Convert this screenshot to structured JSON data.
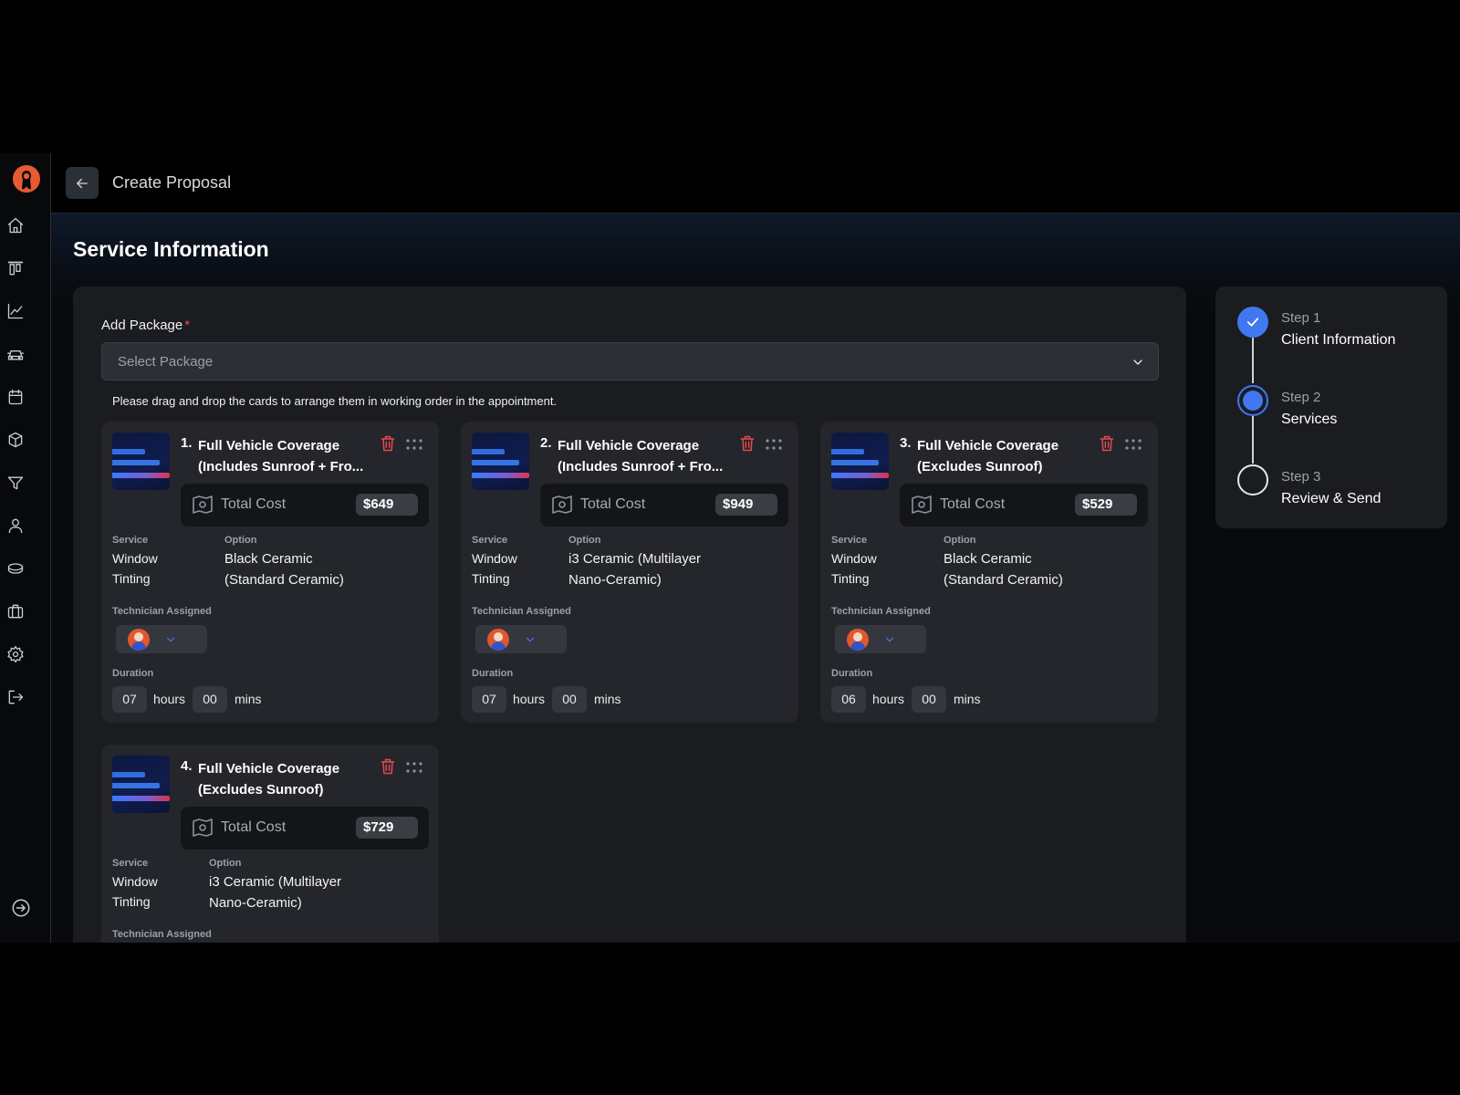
{
  "header": {
    "title": "Create Proposal"
  },
  "section": {
    "title": "Service Information"
  },
  "package": {
    "label": "Add Package",
    "required_mark": "*",
    "placeholder": "Select Package",
    "hint": "Please drag and drop the cards to arrange them in working order in the appointment."
  },
  "labels": {
    "total_cost": "Total Cost",
    "service": "Service",
    "option": "Option",
    "technician": "Technician Assigned",
    "duration": "Duration",
    "hours": "hours",
    "mins": "mins"
  },
  "cards": [
    {
      "num": "1.",
      "title_line1": "Full Vehicle Coverage",
      "title_line2": "(Includes Sunroof + Fro...",
      "cost": "$649",
      "service_line1": "Window",
      "service_line2": "Tinting",
      "option_line1": "Black Ceramic",
      "option_line2": "(Standard Ceramic)",
      "hours": "07",
      "mins": "00"
    },
    {
      "num": "2.",
      "title_line1": "Full Vehicle Coverage",
      "title_line2": "(Includes Sunroof + Fro...",
      "cost": "$949",
      "service_line1": "Window",
      "service_line2": "Tinting",
      "option_line1": "i3 Ceramic (Multilayer",
      "option_line2": "Nano-Ceramic)",
      "hours": "07",
      "mins": "00"
    },
    {
      "num": "3.",
      "title_line1": "Full Vehicle Coverage",
      "title_line2": "(Excludes Sunroof)",
      "cost": "$529",
      "service_line1": "Window",
      "service_line2": "Tinting",
      "option_line1": "Black Ceramic",
      "option_line2": "(Standard Ceramic)",
      "hours": "06",
      "mins": "00"
    },
    {
      "num": "4.",
      "title_line1": "Full Vehicle Coverage",
      "title_line2": "(Excludes Sunroof)",
      "cost": "$729",
      "service_line1": "Window",
      "service_line2": "Tinting",
      "option_line1": "i3 Ceramic (Multilayer",
      "option_line2": "Nano-Ceramic)",
      "hours": "",
      "mins": ""
    }
  ],
  "steps": [
    {
      "number": "Step 1",
      "name": "Client Information",
      "state": "done"
    },
    {
      "number": "Step 2",
      "name": "Services",
      "state": "active"
    },
    {
      "number": "Step 3",
      "name": "Review & Send",
      "state": "todo"
    }
  ],
  "sidebar": {
    "icons": [
      "home-icon",
      "board-icon",
      "chart-icon",
      "car-icon",
      "calendar-icon",
      "box-icon",
      "filter-icon",
      "user-icon",
      "database-icon",
      "briefcase-icon",
      "settings-icon",
      "logout-icon"
    ],
    "bottom_icon": "expand-icon"
  },
  "colors": {
    "accent": "#3f78f0",
    "danger": "#e5484d",
    "logo": "#e85a32"
  }
}
